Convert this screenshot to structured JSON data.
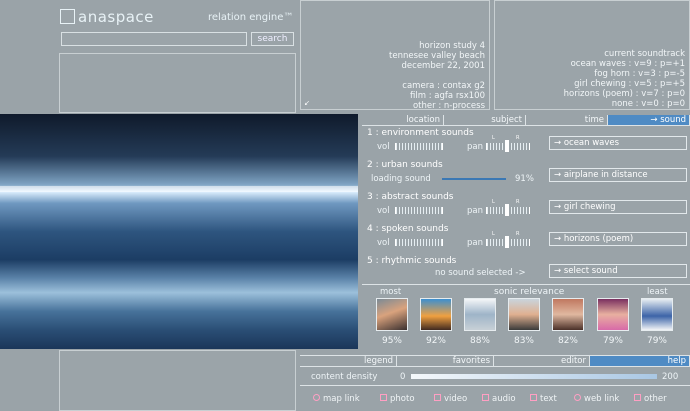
{
  "header": {
    "logo": "anaspace",
    "engine": "relation engine™"
  },
  "search": {
    "placeholder": "",
    "button": "search"
  },
  "photo_info": {
    "title": "horizon study 4",
    "location": "tennesee valley beach",
    "date": "december 22, 2001",
    "camera": "camera : contax g2",
    "film": "film : agfa rsx100",
    "other": "other : n-process"
  },
  "soundtrack": {
    "title": "current soundtrack",
    "items": [
      "ocean waves : v=9 : p=+1",
      "fog horn : v=3 : p=-5",
      "girl chewing : v=5 : p=+5",
      "horizons (poem) : v=7 : p=0",
      "none : v=0 : p=0"
    ]
  },
  "tabs": [
    "location",
    "subject",
    "time",
    "→ sound"
  ],
  "sounds": {
    "environment": {
      "title": "1 : environment sounds",
      "vol": "vol",
      "pan": "pan",
      "select": "ocean waves"
    },
    "urban": {
      "title": "2 : urban sounds",
      "loading": "loading sound",
      "pct": "91%",
      "progress": 0.91,
      "select": "airplane in distance"
    },
    "abstract": {
      "title": "3 : abstract sounds",
      "vol": "vol",
      "pan": "pan",
      "select": "girl chewing"
    },
    "spoken": {
      "title": "4 : spoken sounds",
      "vol": "vol",
      "pan": "pan",
      "select": "horizons (poem)"
    },
    "rhythmic": {
      "title": "5 : rhythmic sounds",
      "none": "no sound selected ->",
      "select": "select sound"
    },
    "pan_marks": {
      "left": "L",
      "right": "R"
    }
  },
  "relevance": {
    "title": "sonic relevance",
    "most": "most",
    "least": "least",
    "items": [
      "95%",
      "92%",
      "88%",
      "83%",
      "82%",
      "79%",
      "79%"
    ]
  },
  "bottom_tabs": [
    "legend",
    "favorites",
    "editor",
    "help"
  ],
  "density": {
    "label": "content density",
    "min": "0",
    "max": "200"
  },
  "links": [
    "map link",
    "photo",
    "video",
    "audio",
    "text",
    "web link",
    "other"
  ]
}
